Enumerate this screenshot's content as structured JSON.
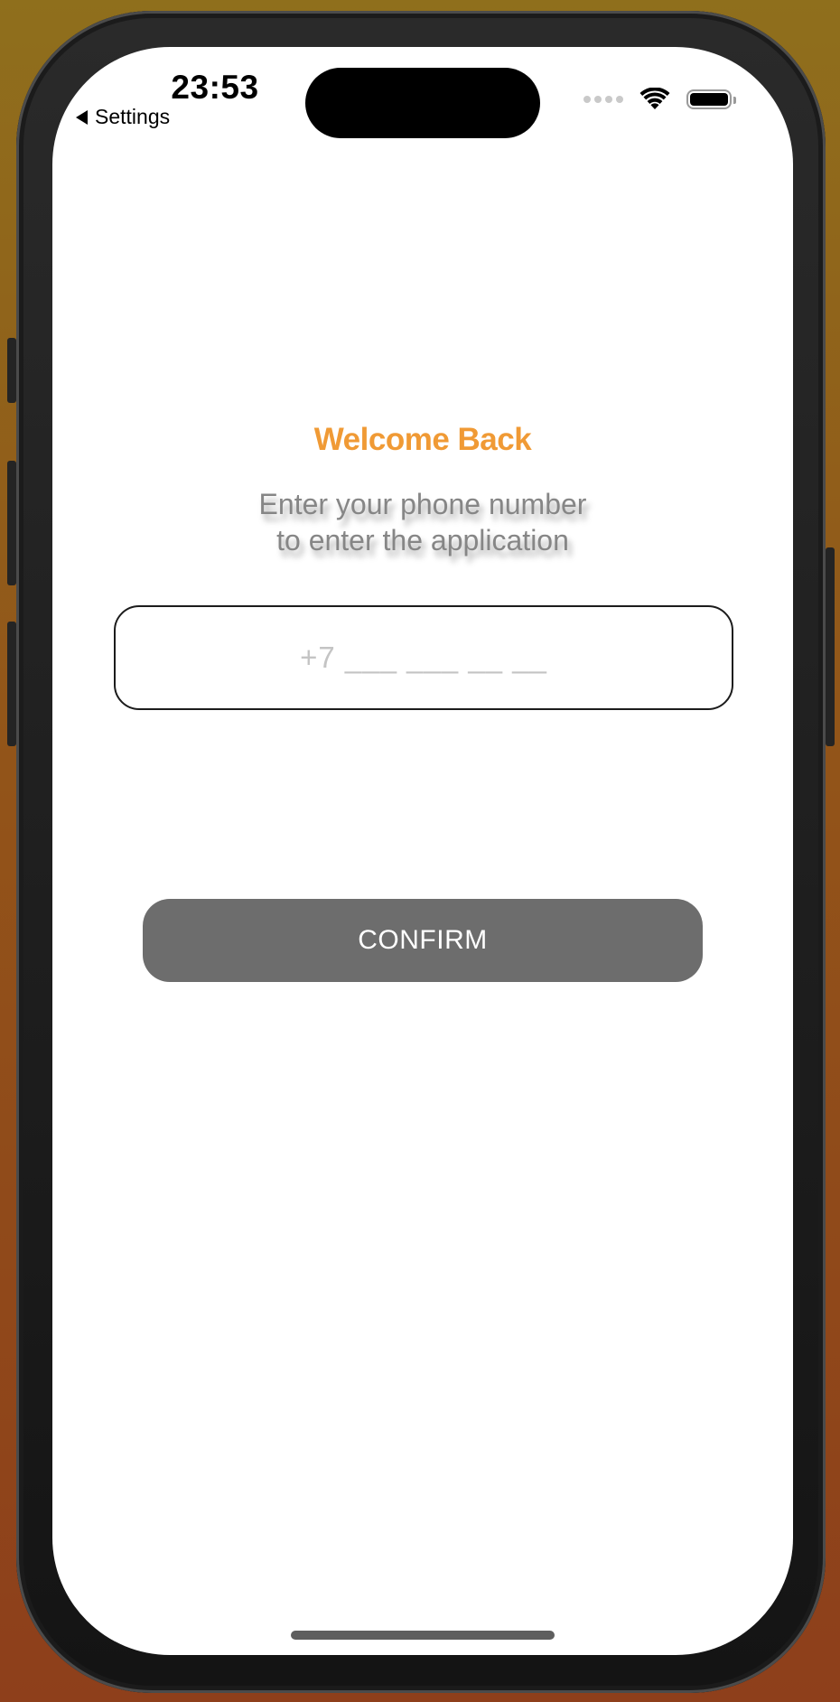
{
  "status_bar": {
    "time": "23:53",
    "back_label": "Settings",
    "icons": [
      "back-triangle-icon",
      "cellular-signal-icon",
      "wifi-icon",
      "battery-icon"
    ]
  },
  "login": {
    "title": "Welcome Back",
    "subtitle_line1": "Enter your phone number",
    "subtitle_line2": "to enter the application",
    "phone_placeholder": "+7 ___ ___ __ __",
    "phone_value": "",
    "confirm_label": "CONFIRM"
  },
  "colors": {
    "accent": "#f09a35",
    "button_bg": "#6d6d6d",
    "subtitle_text": "#868686",
    "placeholder_text": "#c4c4c4"
  }
}
